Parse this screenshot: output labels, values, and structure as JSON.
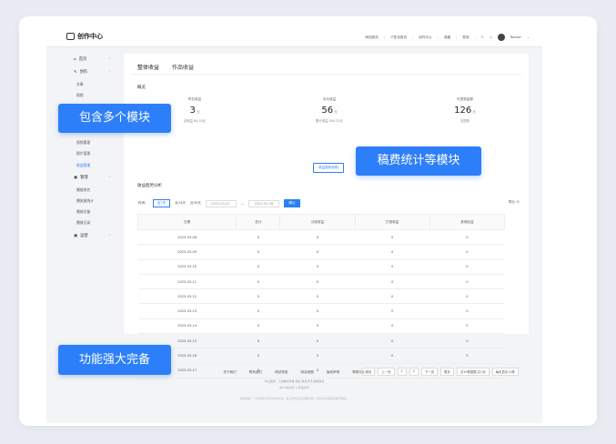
{
  "app": {
    "title": "创作中心"
  },
  "topnav": {
    "items": [
      "网站首页",
      "个性化首页",
      "创作中心",
      "收藏",
      "签到"
    ],
    "user": "Rocker"
  },
  "sidebar": {
    "home": "首页",
    "create": "创作",
    "create_subs": [
      "文章",
      "视频"
    ],
    "mid_subs": [
      "视频管理",
      "图片管理",
      "收益管理"
    ],
    "manage": "管理",
    "manage_subs": [
      "播放排名",
      "播放量统计",
      "播放总量",
      "播放记录"
    ],
    "ops": "运营"
  },
  "tabs": [
    "整体收益",
    "作品收益"
  ],
  "overview": {
    "title": "概览",
    "stats": [
      {
        "label": "昨日收益",
        "value": "3",
        "unit": "元",
        "sub": "总收益 64.33元"
      },
      {
        "label": "本月收益",
        "value": "56",
        "unit": "元",
        "sub": "累计收益 404.32元"
      },
      {
        "label": "可提现金额",
        "value": "126",
        "unit": "元",
        "sub": "去提现"
      }
    ],
    "rule_link": "收益规则说明"
  },
  "trend": {
    "title": "收益趋势分析",
    "time_label": "时间：",
    "ranges": [
      "近7天",
      "近14天",
      "近30天"
    ],
    "start_date": "2023-03-01",
    "end_date": "2023-03-08",
    "query": "确认",
    "export": "导出"
  },
  "table": {
    "headers": [
      "日期",
      "总计",
      "分成收益",
      "打赏收益",
      "其他收益"
    ],
    "rows": [
      [
        "2023-03-08",
        "0",
        "0",
        "0",
        "0"
      ],
      [
        "2023-03-09",
        "0",
        "0",
        "0",
        "0"
      ],
      [
        "2023-03-10",
        "0",
        "0",
        "0",
        "0"
      ],
      [
        "2023-03-11",
        "0",
        "0",
        "0",
        "0"
      ],
      [
        "2023-03-12",
        "0",
        "0",
        "0",
        "0"
      ],
      [
        "2023-03-13",
        "0",
        "0",
        "0",
        "0"
      ],
      [
        "2023-03-14",
        "0",
        "0",
        "0",
        "0"
      ],
      [
        "2023-03-15",
        "0",
        "0",
        "0",
        "0"
      ],
      [
        "2023-03-16",
        "0",
        "0",
        "0",
        "0"
      ],
      [
        "2023-03-17",
        "0",
        "0",
        "0",
        "0"
      ]
    ]
  },
  "pager": {
    "items": [
      "首页",
      "上一页",
      "1",
      "2",
      "下一页",
      "尾页",
      "共10条数据,共1页",
      "每页显示10条"
    ]
  },
  "footer": {
    "links": [
      "关于我们",
      "联系我们",
      "网站导航",
      "网站地图",
      "版权声明",
      "帮助中心"
    ],
    "line1": "中山监控：工信备案号等 地址 联系方式 版权信息",
    "line2": "浙ICP备案号 公安备案号",
    "note": "本网站是一个创作者交流与收益平台，禁止发布违法违规内容，如有侵权请联系我们删除。"
  },
  "badges": {
    "b1": "包含多个模块",
    "b2": "稿费统计等模块",
    "b3": "功能强大完备"
  },
  "colors": {
    "accent": "#2d7ff9"
  }
}
